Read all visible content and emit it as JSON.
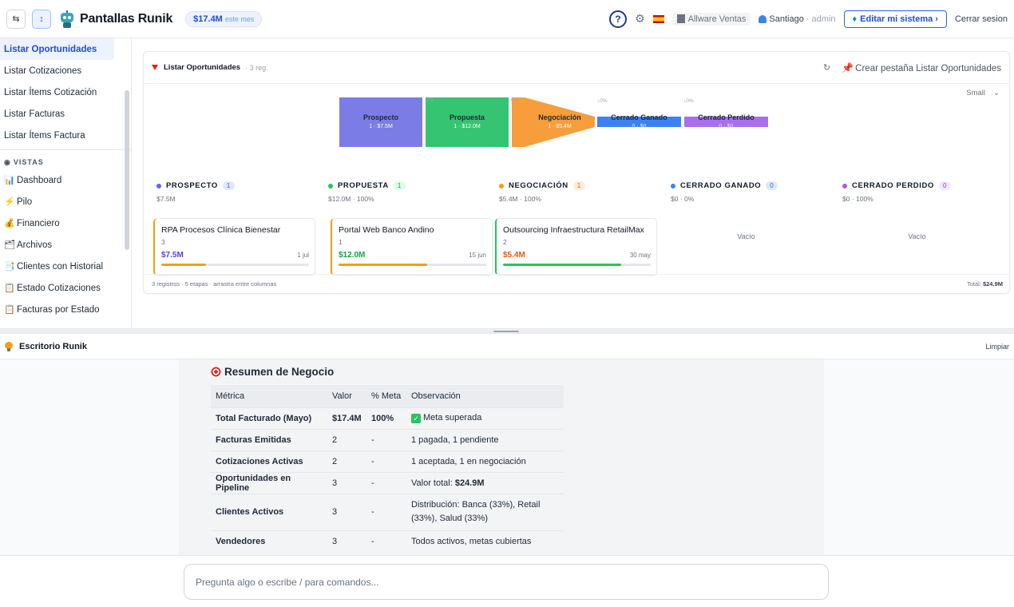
{
  "topbar": {
    "app_title": "Pantallas Runik",
    "revenue": "$17.4M",
    "revenue_note": "este mes",
    "company": "Allware Ventas",
    "user_name": "Santiago",
    "user_role": "· admin",
    "edit_label": "Editar mi sistema ›",
    "logout_label": "Cerrar sesion",
    "help_label": "?"
  },
  "sidebar": {
    "items_top": [
      "Listar Oportunidades",
      "Listar Cotizaciones",
      "Listar Ítems Cotización",
      "Listar Facturas",
      "Listar Ítems Factura"
    ],
    "section_label": "VISTAS",
    "items_views": [
      {
        "label": "Dashboard",
        "icon": "📊",
        "icon_name": "bar-chart-icon"
      },
      {
        "label": "Pilo",
        "icon": "⚡",
        "icon_name": "lightning-icon"
      },
      {
        "label": "Financiero",
        "icon": "💰",
        "icon_name": "money-bag-icon"
      },
      {
        "label": "Archivos",
        "icon": "🗂",
        "icon_name": "folder-icon"
      },
      {
        "label": "Clientes con Historial",
        "icon": "📑",
        "icon_name": "document-icon"
      },
      {
        "label": "Estado Cotizaciones",
        "icon": "📋",
        "icon_name": "clipboard-icon"
      },
      {
        "label": "Facturas por Estado",
        "icon": "📋",
        "icon_name": "clipboard-icon"
      }
    ]
  },
  "card": {
    "title": "Listar Oportunidades",
    "count": "· 3 reg.",
    "create_tab": "Crear pestaña Listar Oportunidades",
    "size_label": "Small",
    "footer_left": "3 registros · 5 etapas · arrastra entre columnas",
    "footer_total_label": "Total:",
    "footer_total": "$24.9M"
  },
  "funnel": [
    {
      "name": "Prospecto",
      "sub": "1 · $7.5M",
      "color": "#7c7ce6"
    },
    {
      "name": "Propuesta",
      "sub": "1 · $12.0M",
      "color": "#35c472"
    },
    {
      "name": "Negociación",
      "sub": "1 · $5.4M",
      "color": "#f59e3b"
    },
    {
      "name": "Cerrado Ganado",
      "sub": "0 · $0",
      "color": "#3b82f6"
    },
    {
      "name": "Cerrado Perdido",
      "sub": "0 · $0",
      "color": "#a96ef0"
    }
  ],
  "funnel_pct": [
    "0%",
    "0%",
    "↓0%",
    "↓0%"
  ],
  "stages": [
    {
      "name": "PROSPECTO",
      "count": "1",
      "sub": "$7.5M",
      "color": "#6366f1",
      "badge_bg": "#e0e7ff",
      "badge_fg": "#4f46e5"
    },
    {
      "name": "PROPUESTA",
      "count": "1",
      "sub": "$12.0M · 100%",
      "color": "#22c55e",
      "badge_bg": "#dcfce7",
      "badge_fg": "#16a34a"
    },
    {
      "name": "NEGOCIACIÓN",
      "count": "1",
      "sub": "$5.4M · 100%",
      "color": "#f59e0b",
      "badge_bg": "#ffedd5",
      "badge_fg": "#ea580c"
    },
    {
      "name": "CERRADO GANADO",
      "count": "0",
      "sub": "$0 · 0%",
      "color": "#3b82f6",
      "badge_bg": "#dbeafe",
      "badge_fg": "#2563eb"
    },
    {
      "name": "CERRADO PERDIDO",
      "count": "0",
      "sub": "$0 · 100%",
      "color": "#a855f7",
      "badge_bg": "#f3e8ff",
      "badge_fg": "#9333ea"
    }
  ],
  "deals": [
    {
      "name": "RPA Procesos Clínica Bienestar",
      "num": "3",
      "amount": "$7.5M",
      "date": "1 jul",
      "accent": "#f59e0b",
      "amount_color": "#4f46e5",
      "progress": 0.3
    },
    {
      "name": "Portal Web Banco Andino",
      "num": "1",
      "amount": "$12.0M",
      "date": "15 jun",
      "accent": "#f59e0b",
      "amount_color": "#16a34a",
      "progress": 0.6
    },
    {
      "name": "Outsourcing Infraestructura RetailMax",
      "num": "2",
      "amount": "$5.4M",
      "date": "30 may",
      "accent": "#22c55e",
      "amount_color": "#ea580c",
      "progress": 0.8
    }
  ],
  "empty_label": "Vacío",
  "desk": {
    "title": "Escritorio Runik",
    "clear_label": "Limpiar",
    "summary_title": "Resumen de Negocio",
    "columns": [
      "Métrica",
      "Valor",
      "% Meta",
      "Observación"
    ],
    "rows": [
      {
        "metric": "Total Facturado (Mayo)",
        "value": "$17.4M",
        "meta": "100%",
        "obs": "Meta superada",
        "check": true
      },
      {
        "metric": "Facturas Emitidas",
        "value": "2",
        "meta": "-",
        "obs": "1 pagada, 1 pendiente"
      },
      {
        "metric": "Cotizaciones Activas",
        "value": "2",
        "meta": "-",
        "obs": "1 aceptada, 1 en negociación"
      },
      {
        "metric": "Oportunidades en Pipeline",
        "value": "3",
        "meta": "-",
        "obs_prefix": "Valor total: ",
        "obs_bold": "$24.9M"
      },
      {
        "metric": "Clientes Activos",
        "value": "3",
        "meta": "-",
        "obs": "Distribución: Banca (33%), Retail (33%), Salud (33%)",
        "tall": true
      },
      {
        "metric": "Vendedores",
        "value": "3",
        "meta": "-",
        "obs": "Todos activos, metas cubiertas"
      }
    ]
  },
  "input": {
    "placeholder": "Pregunta algo o escribe / para comandos..."
  }
}
